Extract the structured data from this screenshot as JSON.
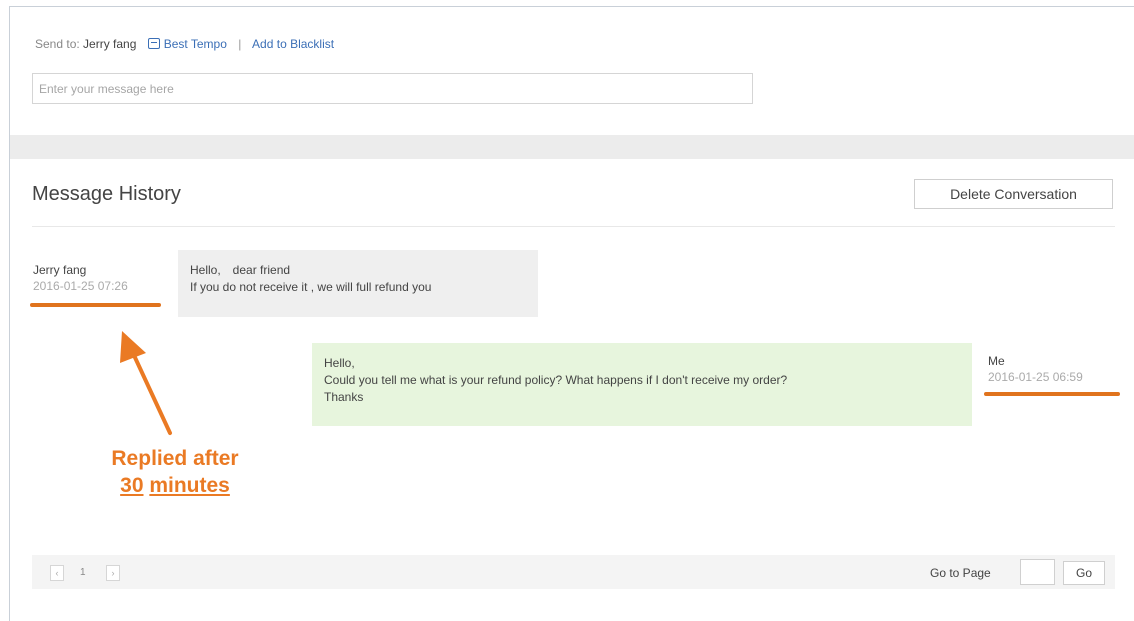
{
  "compose": {
    "send_to_label": "Send to:",
    "recipient": "Jerry fang",
    "store_link": "Best Tempo",
    "separator": "|",
    "blacklist_link": "Add to Blacklist",
    "message_placeholder": "Enter your message here"
  },
  "history": {
    "title": "Message History",
    "delete_label": "Delete Conversation",
    "messages": [
      {
        "sender": "Jerry fang",
        "time": "2016-01-25 07:26",
        "lines": [
          "Hello,　dear friend",
          "If you do not receive it , we will full refund you"
        ]
      },
      {
        "sender": "Me",
        "time": "2016-01-25 06:59",
        "lines": [
          "Hello,",
          "Could you tell me what is your refund policy? What happens if I don't receive my order?",
          "Thanks"
        ]
      }
    ]
  },
  "annotation": {
    "line1": "Replied after",
    "number": "30",
    "unit": "minutes",
    "color": "#ea7a24"
  },
  "pager": {
    "prev_icon": "chevron-left-icon",
    "current_page": "1",
    "next_icon": "chevron-right-icon",
    "goto_label": "Go to Page",
    "go_label": "Go"
  },
  "colors": {
    "link": "#3b6fb6",
    "incoming_bubble": "#efefef",
    "outgoing_bubble": "#e7f5dd",
    "highlight": "#e0731d"
  }
}
